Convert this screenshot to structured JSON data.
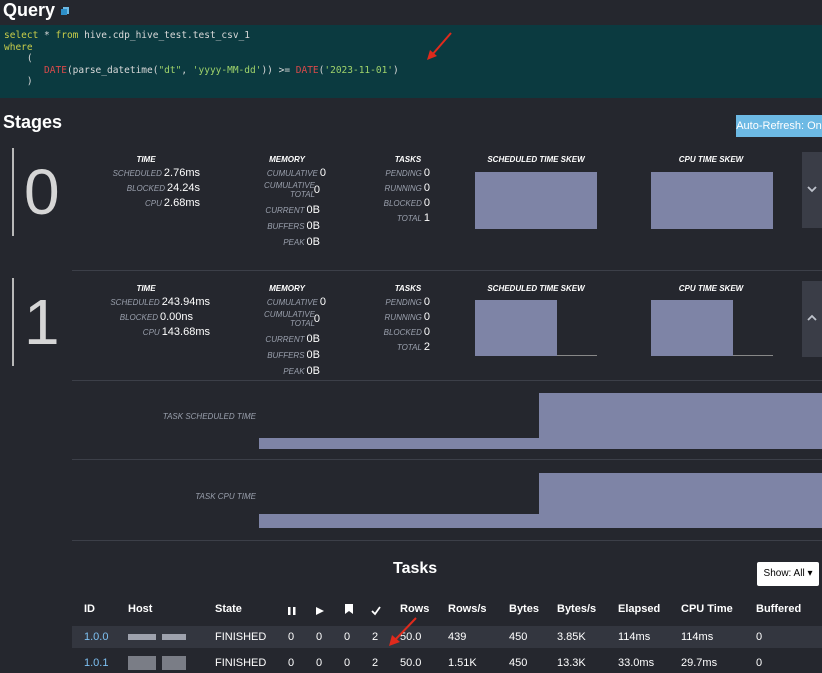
{
  "query": {
    "title": "Query",
    "lines": [
      {
        "kw": "select",
        "rest": " * ",
        "kw2": "from",
        "rest2": " hive.cdp_hive_test.test_csv_1"
      },
      {
        "kw": "where"
      },
      {
        "plain": "    ("
      },
      {
        "fn": "DATE",
        "a": "(parse_datetime(",
        "s1": "\"dt\"",
        "b": ", ",
        "s2": "'yyyy-MM-dd'",
        "c": ")) >= ",
        "fn2": "DATE",
        "d": "(",
        "s3": "'2023-11-01'",
        "e": ")"
      },
      {
        "plain": "    )"
      }
    ]
  },
  "stages_title": "Stages",
  "auto_refresh": "Auto-Refresh: On",
  "headers": {
    "time": "TIME",
    "memory": "MEMORY",
    "tasks": "TASKS",
    "sched_skew": "SCHEDULED TIME SKEW",
    "cpu_skew": "CPU TIME SKEW"
  },
  "labels": {
    "scheduled": "SCHEDULED",
    "blocked": "BLOCKED",
    "cpu": "CPU",
    "cumulative": "CUMULATIVE",
    "cumulative_total_1": "CUMULATIVE",
    "cumulative_total_2": "TOTAL",
    "current": "CURRENT",
    "buffers": "BUFFERS",
    "peak": "PEAK",
    "pending": "PENDING",
    "running": "RUNNING",
    "t_blocked": "BLOCKED",
    "total": "TOTAL"
  },
  "stages": [
    {
      "id": "0",
      "scheduled": "2.76ms",
      "blocked": "24.24s",
      "cpu": "2.68ms",
      "cumulative": "0",
      "cumulative_total": "0",
      "current": "0B",
      "buffers": "0B",
      "peak": "0B",
      "pending": "0",
      "running": "0",
      "t_blocked": "0",
      "total": "1",
      "toggle_icon": "chevron-down"
    },
    {
      "id": "1",
      "scheduled": "243.94ms",
      "blocked": "0.00ns",
      "cpu": "143.68ms",
      "cumulative": "0",
      "cumulative_total": "0",
      "current": "0B",
      "buffers": "0B",
      "peak": "0B",
      "pending": "0",
      "running": "0",
      "t_blocked": "0",
      "total": "2",
      "toggle_icon": "chevron-up"
    }
  ],
  "task_sched_label": "TASK SCHEDULED TIME",
  "task_cpu_label": "TASK CPU TIME",
  "tasks_title": "Tasks",
  "show_btn": "Show: All ▾",
  "table": {
    "headers": [
      "ID",
      "Host",
      "State",
      "",
      "",
      "",
      "",
      "Rows",
      "Rows/s",
      "Bytes",
      "Bytes/s",
      "Elapsed",
      "CPU Time",
      "Buffered"
    ],
    "header_icons": [
      "pause-icon",
      "play-icon",
      "bookmark-icon",
      "check-icon"
    ],
    "rows": [
      {
        "id": "1.0.0",
        "state": "FINISHED",
        "c1": "0",
        "c2": "0",
        "c3": "0",
        "c4": "2",
        "rows": "50.0",
        "rows_s": "439",
        "bytes": "450",
        "bytes_s": "3.85K",
        "elapsed": "114ms",
        "cpu": "114ms",
        "buffered": "0"
      },
      {
        "id": "1.0.1",
        "state": "FINISHED",
        "c1": "0",
        "c2": "0",
        "c3": "0",
        "c4": "2",
        "rows": "50.0",
        "rows_s": "1.51K",
        "bytes": "450",
        "bytes_s": "13.3K",
        "elapsed": "33.0ms",
        "cpu": "29.7ms",
        "buffered": "0"
      }
    ]
  },
  "colors": {
    "accent": "#6cb9e4",
    "bar": "#7e84a6",
    "annotation_arrow": "#e02a1c",
    "query_bg": "#0b3a40"
  }
}
